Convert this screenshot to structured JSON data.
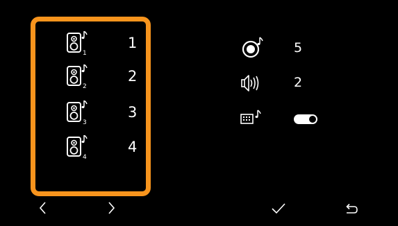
{
  "speakers": {
    "items": [
      {
        "number": "1",
        "subscript": "1"
      },
      {
        "number": "2",
        "subscript": "2"
      },
      {
        "number": "3",
        "subscript": "3"
      },
      {
        "number": "4",
        "subscript": "4"
      }
    ]
  },
  "settings": {
    "subwoofer": {
      "icon": "subwoofer-note-icon",
      "value": "5"
    },
    "volume": {
      "icon": "speaker-volume-icon",
      "value": "2"
    },
    "keyboard_sound": {
      "icon": "keypad-note-icon",
      "state": "on"
    }
  },
  "nav": {
    "prev_icon": "chevron-left-icon",
    "next_icon": "chevron-right-icon",
    "confirm_icon": "check-icon",
    "back_icon": "return-icon"
  },
  "colors": {
    "accent": "#f7941d",
    "background": "#000000",
    "foreground": "#ffffff"
  }
}
